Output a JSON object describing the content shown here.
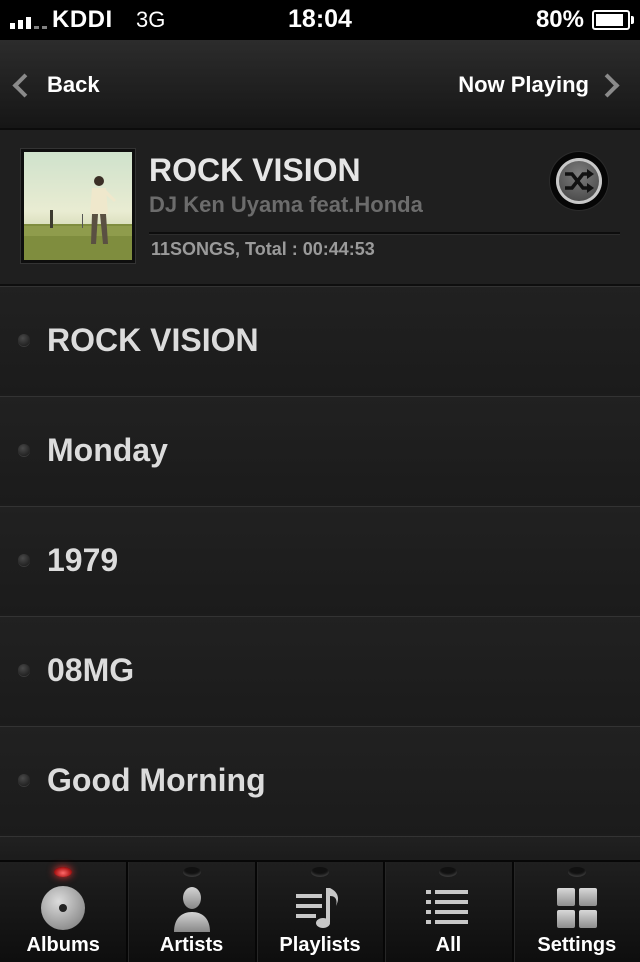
{
  "status_bar": {
    "carrier": "KDDI",
    "network": "3G",
    "time": "18:04",
    "battery_percent": "80%",
    "battery_level": 0.8,
    "signal_bars": 3
  },
  "nav": {
    "back_label": "Back",
    "forward_label": "Now Playing"
  },
  "album": {
    "title": "ROCK VISION",
    "artist": "DJ Ken Uyama feat.Honda",
    "info": "11SONGS, Total : 00:44:53",
    "shuffle_icon": "shuffle-icon"
  },
  "tracks": [
    {
      "name": "ROCK VISION"
    },
    {
      "name": "Monday"
    },
    {
      "name": "1979"
    },
    {
      "name": "08MG"
    },
    {
      "name": "Good Morning"
    }
  ],
  "tabs": [
    {
      "label": "Albums",
      "icon": "disc-icon",
      "active": true
    },
    {
      "label": "Artists",
      "icon": "person-icon",
      "active": false
    },
    {
      "label": "Playlists",
      "icon": "playlist-icon",
      "active": false
    },
    {
      "label": "All",
      "icon": "list-icon",
      "active": false
    },
    {
      "label": "Settings",
      "icon": "grid-icon",
      "active": false
    }
  ],
  "colors": {
    "background": "#1c1c1c",
    "active_tab_indicator": "#e33333",
    "secondary_text": "#6c6c6c"
  }
}
